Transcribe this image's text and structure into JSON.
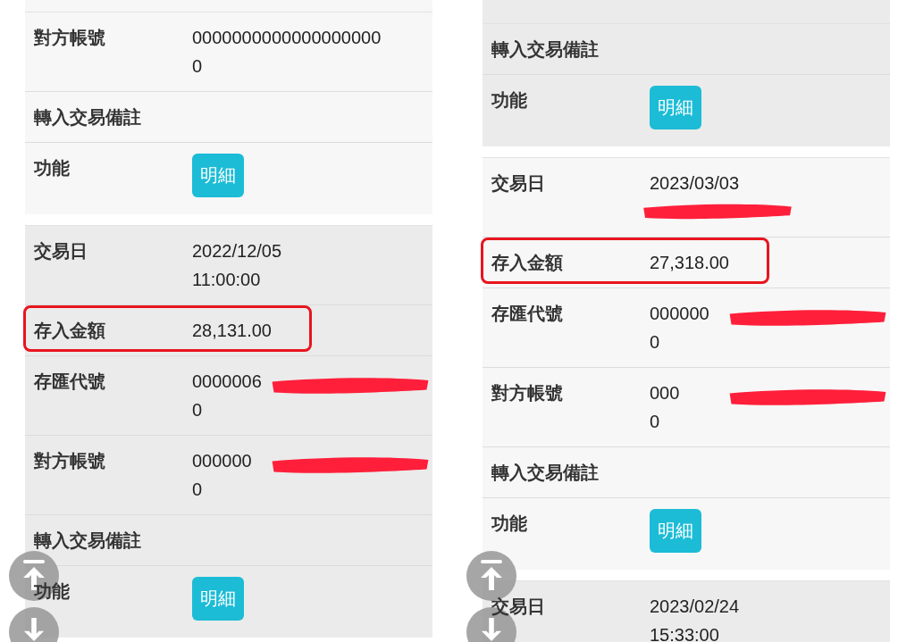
{
  "panels": [
    {
      "cards": [
        {
          "shaded": false,
          "rows": [
            {
              "kind": "text",
              "label": "對方帳號",
              "lines": [
                "0000000000000000000",
                "0"
              ],
              "highlighted": false,
              "redacted": false
            },
            {
              "kind": "text",
              "label": "轉入交易備註",
              "lines": [],
              "highlighted": false,
              "redacted": false
            },
            {
              "kind": "action",
              "label": "功能",
              "button": "明細",
              "highlighted": false,
              "redacted": false
            }
          ]
        },
        {
          "shaded": true,
          "rows": [
            {
              "kind": "text",
              "label": "交易日",
              "lines": [
                "2022/12/05",
                "11:00:00"
              ],
              "highlighted": false,
              "redacted": false
            },
            {
              "kind": "text",
              "label": "存入金額",
              "lines": [
                "28,131.00"
              ],
              "highlighted": true,
              "redacted": false
            },
            {
              "kind": "text",
              "label": "存匯代號",
              "lines": [
                "0000006",
                "0"
              ],
              "highlighted": false,
              "redacted": true
            },
            {
              "kind": "text",
              "label": "對方帳號",
              "lines": [
                "000000",
                "0"
              ],
              "highlighted": false,
              "redacted": true
            },
            {
              "kind": "text",
              "label": "轉入交易備註",
              "lines": [],
              "highlighted": false,
              "redacted": false
            },
            {
              "kind": "action",
              "label": "功能",
              "button": "明細",
              "highlighted": false,
              "redacted": false
            }
          ]
        }
      ]
    },
    {
      "cards": [
        {
          "shaded": true,
          "rows": [
            {
              "kind": "text",
              "label": "轉入交易備註",
              "lines": [],
              "highlighted": false,
              "redacted": false
            },
            {
              "kind": "action",
              "label": "功能",
              "button": "明細",
              "highlighted": false,
              "redacted": false
            }
          ]
        },
        {
          "shaded": false,
          "rows": [
            {
              "kind": "text",
              "label": "交易日",
              "lines": [
                "2023/03/03"
              ],
              "highlighted": false,
              "redacted": true
            },
            {
              "kind": "text",
              "label": "存入金額",
              "lines": [
                "27,318.00"
              ],
              "highlighted": true,
              "redacted": false
            },
            {
              "kind": "text",
              "label": "存匯代號",
              "lines": [
                "000000",
                "0"
              ],
              "highlighted": false,
              "redacted": true
            },
            {
              "kind": "text",
              "label": "對方帳號",
              "lines": [
                "000",
                "0"
              ],
              "highlighted": false,
              "redacted": true
            },
            {
              "kind": "text",
              "label": "轉入交易備註",
              "lines": [],
              "highlighted": false,
              "redacted": false
            },
            {
              "kind": "action",
              "label": "功能",
              "button": "明細",
              "highlighted": false,
              "redacted": false
            }
          ]
        },
        {
          "shaded": true,
          "rows": [
            {
              "kind": "text",
              "label": "交易日",
              "lines": [
                "2023/02/24",
                "15:33:00"
              ],
              "highlighted": false,
              "redacted": false
            }
          ]
        }
      ]
    }
  ]
}
